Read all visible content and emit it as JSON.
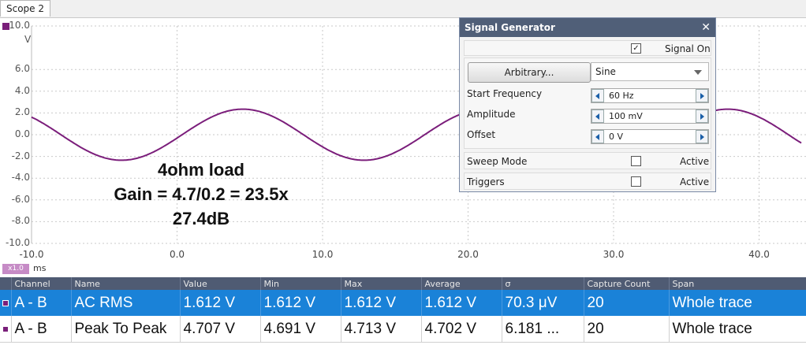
{
  "tab": {
    "label": "Scope 2"
  },
  "axis": {
    "y_unit": "V",
    "y_ticks": [
      "10.0",
      "6.0",
      "4.0",
      "2.0",
      "0.0",
      "-2.0",
      "-4.0",
      "-6.0",
      "-8.0",
      "-10.0"
    ],
    "x_ticks": [
      "-10.0",
      "0.0",
      "10.0",
      "20.0",
      "30.0",
      "40.0"
    ],
    "x_unit": "ms",
    "zoom": "x1.0"
  },
  "chart_data": {
    "type": "line",
    "xlabel": "ms",
    "ylabel": "V",
    "xlim": [
      -10,
      43
    ],
    "ylim": [
      -10,
      10
    ],
    "grid": true,
    "series": [
      {
        "amplitude": 2.35,
        "frequency_hz": 60,
        "values_note": "",
        "color": "#7b1e7b"
      }
    ]
  },
  "annotation": {
    "line1": "4ohm load",
    "line2": "Gain = 4.7/0.2 = 23.5x",
    "line3": "27.4dB"
  },
  "signal_generator": {
    "title": "Signal Generator",
    "signal_on_label": "Signal On",
    "signal_on": true,
    "arbitrary_label": "Arbitrary...",
    "waveform": "Sine",
    "start_frequency_label": "Start Frequency",
    "start_frequency": "60 Hz",
    "amplitude_label": "Amplitude",
    "amplitude": "100 mV",
    "offset_label": "Offset",
    "offset": "0 V",
    "sweep_mode_label": "Sweep Mode",
    "sweep_active_label": "Active",
    "triggers_label": "Triggers",
    "triggers_active_label": "Active"
  },
  "measurements": {
    "headers": [
      "Channel",
      "Name",
      "Value",
      "Min",
      "Max",
      "Average",
      "σ",
      "Capture Count",
      "Span"
    ],
    "rows": [
      {
        "channel": "A - B",
        "name": "AC RMS",
        "value": "1.612 V",
        "min": "1.612 V",
        "max": "1.612 V",
        "average": "1.612 V",
        "sigma": "70.3 μV",
        "count": "20",
        "span": "Whole trace"
      },
      {
        "channel": "A - B",
        "name": "Peak To Peak",
        "value": "4.707 V",
        "min": "4.691 V",
        "max": "4.713 V",
        "average": "4.702 V",
        "sigma": "6.181 ...",
        "count": "20",
        "span": "Whole trace"
      }
    ]
  },
  "colors": {
    "trace": "#7b1e7b",
    "selected_row": "#1a82d8",
    "header": "#4f5b73"
  }
}
